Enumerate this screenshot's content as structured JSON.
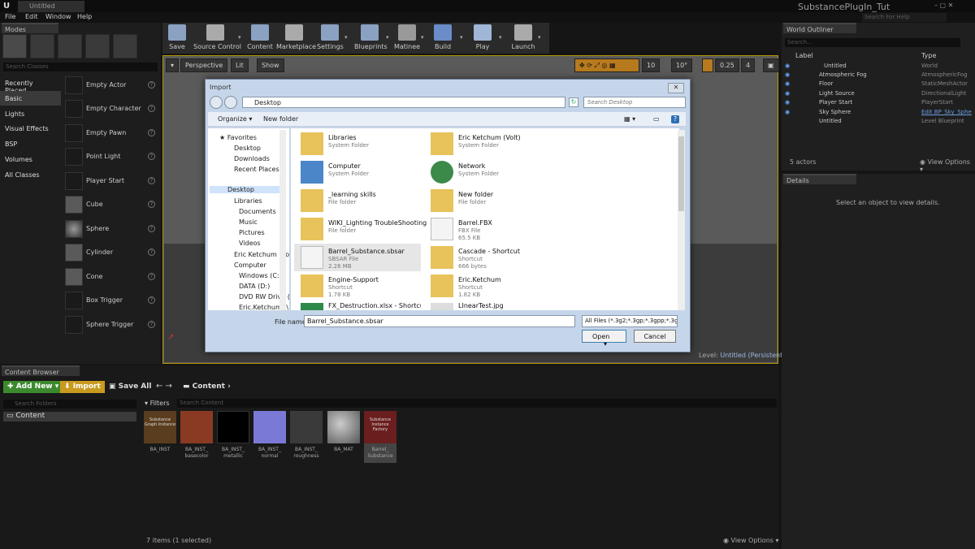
{
  "window": {
    "tab": "Untitled",
    "project_title": "SubstancePlugIn_Tut",
    "help_search_placeholder": "Search For Help"
  },
  "menu": [
    "File",
    "Edit",
    "Window",
    "Help"
  ],
  "modes": {
    "tab": "Modes",
    "search_placeholder": "Search Classes",
    "categories": [
      "Recently Placed",
      "Basic",
      "Lights",
      "Visual Effects",
      "BSP",
      "Volumes",
      "All Classes"
    ],
    "items": [
      "Empty Actor",
      "Empty Character",
      "Empty Pawn",
      "Point Light",
      "Player Start",
      "Cube",
      "Sphere",
      "Cylinder",
      "Cone",
      "Box Trigger",
      "Sphere Trigger"
    ]
  },
  "toolbar": [
    "Save",
    "Source Control",
    "Content",
    "Marketplace",
    "Settings",
    "Blueprints",
    "Matinee",
    "Build",
    "Play",
    "Launch"
  ],
  "viewport": {
    "perspective": "Perspective",
    "lit": "Lit",
    "show": "Show",
    "grid": "10",
    "rot": "10°",
    "scale": "0.25",
    "cam": "4",
    "level_prefix": "Level:",
    "level_name": "Untitled (Persistent)"
  },
  "dialog": {
    "title": "Import",
    "address": "Desktop",
    "search": "Search Desktop",
    "organize": "Organize",
    "new_folder": "New folder",
    "nav": [
      "Favorites",
      "Desktop",
      "Downloads",
      "Recent Places",
      "Desktop",
      "Libraries",
      "Documents",
      "Music",
      "Pictures",
      "Videos",
      "Eric Ketchum (Vo",
      "Computer",
      "Windows (C:)",
      "DATA (D:)",
      "DVD RW Drive (",
      "Eric.Ketchum (\\"
    ],
    "files": [
      {
        "name": "Libraries",
        "type": "System Folder",
        "size": ""
      },
      {
        "name": "Eric Ketchum (Volt)",
        "type": "System Folder",
        "size": ""
      },
      {
        "name": "Computer",
        "type": "System Folder",
        "size": ""
      },
      {
        "name": "Network",
        "type": "System Folder",
        "size": ""
      },
      {
        "name": "_learning skills",
        "type": "File folder",
        "size": ""
      },
      {
        "name": "New folder",
        "type": "File folder",
        "size": ""
      },
      {
        "name": "WIKI_Lighting TroubleShooting",
        "type": "File folder",
        "size": ""
      },
      {
        "name": "Barrel.FBX",
        "type": "FBX File",
        "size": "65.5 KB"
      },
      {
        "name": "Barrel_Substance.sbsar",
        "type": "SBSAR File",
        "size": "2.26 MB"
      },
      {
        "name": "Cascade - Shortcut",
        "type": "Shortcut",
        "size": "666 bytes"
      },
      {
        "name": "Engine-Support",
        "type": "Shortcut",
        "size": "1.78 KB"
      },
      {
        "name": "Eric.Ketchum",
        "type": "Shortcut",
        "size": "1.82 KB"
      },
      {
        "name": "FX_Destruction.xlsx - Shortcut",
        "type": "",
        "size": ""
      },
      {
        "name": "LInearTest.jpg",
        "type": "",
        "size": ""
      }
    ],
    "filename_label": "File name:",
    "filename": "Barrel_Substance.sbsar",
    "filetype": "All Files (*.3g2;*.3gp;*.3gpp;*.3g",
    "open": "Open",
    "cancel": "Cancel"
  },
  "outliner": {
    "tab": "World Outliner",
    "search_placeholder": "Search...",
    "col_label": "Label",
    "col_type": "Type",
    "rows": [
      {
        "label": "Untitled",
        "type": "World"
      },
      {
        "label": "Atmospheric Fog",
        "type": "AtmosphericFog"
      },
      {
        "label": "Floor",
        "type": "StaticMeshActor"
      },
      {
        "label": "Light Source",
        "type": "DirectionalLight"
      },
      {
        "label": "Player Start",
        "type": "PlayerStart"
      },
      {
        "label": "Sky Sphere",
        "type": "Edit BP_Sky_Sphe"
      },
      {
        "label": "Untitled",
        "type": "Level Blueprint"
      }
    ],
    "count": "5 actors",
    "view_options": "View Options"
  },
  "details": {
    "tab": "Details",
    "empty": "Select an object to view details."
  },
  "content_browser": {
    "tab": "Content Browser",
    "add_new": "Add New",
    "import": "Import",
    "save_all": "Save All",
    "path": "Content",
    "search_folders": "Search Folders",
    "folder": "Content",
    "filters": "Filters",
    "search_content": "Search Content",
    "assets": [
      {
        "label": "BA_INST",
        "thumb_text": "Substance Graph Instance",
        "color": "#5a3d1e"
      },
      {
        "label": "BA_INST_ basecolor",
        "thumb_text": "",
        "color": "#8a3a22"
      },
      {
        "label": "BA_INST_ metallic",
        "thumb_text": "",
        "color": "#000000"
      },
      {
        "label": "BA_INST_ normal",
        "thumb_text": "",
        "color": "#7a7ad6"
      },
      {
        "label": "BA_INST_ roughness",
        "thumb_text": "",
        "color": "#3a3a3a"
      },
      {
        "label": "BA_MAT",
        "thumb_text": "",
        "color": "#9a9a9a"
      },
      {
        "label": "Barrel_ Substance",
        "thumb_text": "Substance Instance Factory",
        "color": "#6b1e1e"
      }
    ],
    "status": "7 items (1 selected)",
    "view_options": "View Options"
  }
}
